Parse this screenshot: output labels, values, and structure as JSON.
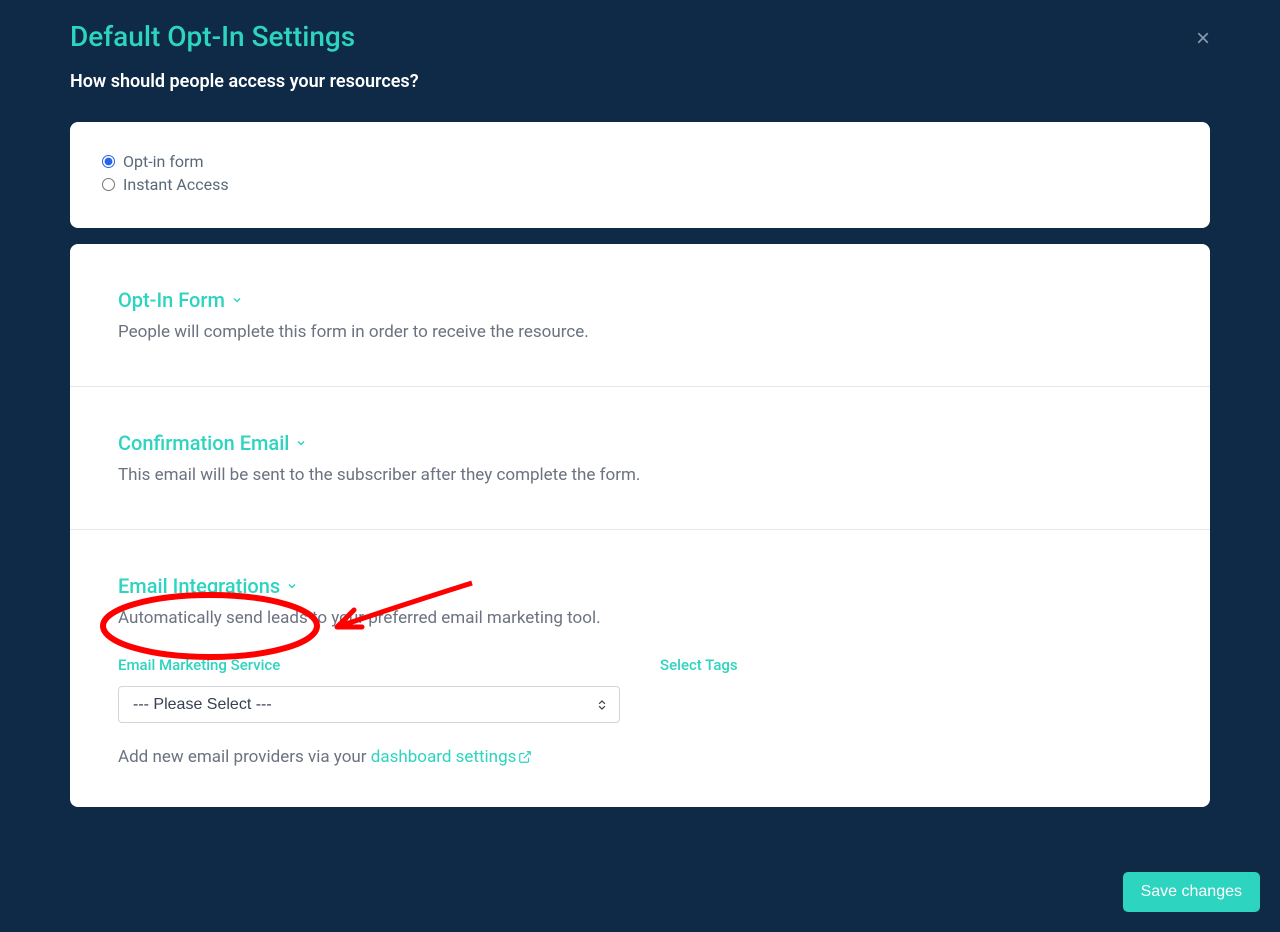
{
  "modal": {
    "title": "Default Opt-In Settings",
    "subtitle": "How should people access your resources?"
  },
  "access_options": {
    "opt_in_form": "Opt-in form",
    "instant_access": "Instant Access"
  },
  "sections": {
    "optin_form": {
      "title": "Opt-In Form",
      "desc": "People will complete this form in order to receive the resource."
    },
    "confirmation_email": {
      "title": "Confirmation Email",
      "desc": "This email will be sent to the subscriber after they complete the form."
    },
    "email_integrations": {
      "title": "Email Integrations",
      "desc": "Automatically send leads to your preferred email marketing tool.",
      "service_label": "Email Marketing Service",
      "tags_label": "Select Tags",
      "select_placeholder": "--- Please Select ---",
      "helper_prefix": "Add new email providers via your ",
      "helper_link": "dashboard settings"
    }
  },
  "buttons": {
    "save": "Save changes"
  }
}
